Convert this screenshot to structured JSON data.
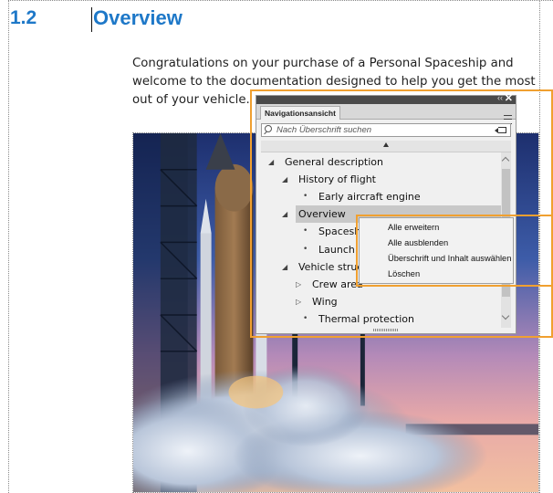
{
  "section": {
    "number": "1.2",
    "title": "Overview"
  },
  "paragraph": "Congratulations on your purchase of a Personal Spaceship and welcome to the documentation designed to help you get the most out of your vehicle.",
  "nav_panel": {
    "tab_label": "Navigationsansicht",
    "collapse_glyph": "‹‹",
    "close_glyph": "✕",
    "search_placeholder": "Nach Überschrift suchen",
    "tree": [
      {
        "label": "General description",
        "level": 0,
        "marker": "expanded"
      },
      {
        "label": "History of flight",
        "level": 1,
        "marker": "expanded"
      },
      {
        "label": "Early aircraft engine",
        "level": 2,
        "marker": "leaf"
      },
      {
        "label": "Overview",
        "level": 1,
        "marker": "expanded",
        "selected": true
      },
      {
        "label": "Spaceship",
        "level": 2,
        "marker": "leaf"
      },
      {
        "label": "Launch and",
        "level": 2,
        "marker": "leaf"
      },
      {
        "label": "Vehicle structu",
        "level": 1,
        "marker": "expanded"
      },
      {
        "label": "Crew area",
        "level": 2,
        "marker": "collapsed"
      },
      {
        "label": "Wing",
        "level": 2,
        "marker": "collapsed"
      },
      {
        "label": "Thermal protection",
        "level": 2,
        "marker": "leaf"
      }
    ]
  },
  "context_menu": {
    "items": [
      "Alle erweitern",
      "Alle ausblenden",
      "Überschrift und Inhalt auswählen",
      "Löschen"
    ]
  },
  "colors": {
    "heading": "#1e78c8",
    "highlight": "#f0a030",
    "panel_bg": "#f0f0f0",
    "selection": "#c8c8c8"
  },
  "icons": {
    "search": "search-icon",
    "clear": "clear-search-icon",
    "menu": "panel-menu-icon",
    "close": "close-icon"
  }
}
